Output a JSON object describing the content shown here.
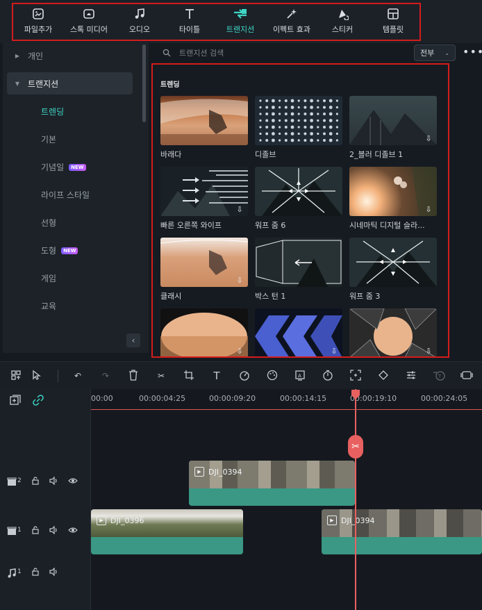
{
  "toolbar": {
    "items": [
      {
        "label": "파일추가",
        "icon": "media-import-icon"
      },
      {
        "label": "스톡 미디어",
        "icon": "stock-media-icon"
      },
      {
        "label": "오디오",
        "icon": "music-note-icon"
      },
      {
        "label": "타이틀",
        "icon": "title-text-icon"
      },
      {
        "label": "트랜지션",
        "icon": "transition-icon"
      },
      {
        "label": "이펙트 효과",
        "icon": "effects-icon"
      },
      {
        "label": "스티커",
        "icon": "sticker-icon"
      },
      {
        "label": "템플릿",
        "icon": "template-icon"
      }
    ],
    "active_index": 4
  },
  "sidebar": {
    "items": [
      {
        "label": "개인",
        "expanded": false
      },
      {
        "label": "트랜지션",
        "expanded": true
      }
    ],
    "sub_items": [
      {
        "label": "트렌딩",
        "active": true,
        "new": false
      },
      {
        "label": "기본",
        "active": false,
        "new": false
      },
      {
        "label": "기념일",
        "active": false,
        "new": true
      },
      {
        "label": "라이프 스타일",
        "active": false,
        "new": false
      },
      {
        "label": "선형",
        "active": false,
        "new": false
      },
      {
        "label": "도형",
        "active": false,
        "new": true
      },
      {
        "label": "게임",
        "active": false,
        "new": false
      },
      {
        "label": "교육",
        "active": false,
        "new": false
      }
    ],
    "new_badge": "NEW"
  },
  "search": {
    "placeholder": "트랜지션 검색"
  },
  "filter": {
    "value": "전부"
  },
  "section": {
    "title": "트렌딩"
  },
  "cards": [
    {
      "name": "바래다",
      "download": false
    },
    {
      "name": "디졸브",
      "download": false
    },
    {
      "name": "2_블러 디졸브 1",
      "download": true
    },
    {
      "name": "빠른 오른쪽 와이프",
      "download": true
    },
    {
      "name": "워프 줌 6",
      "download": false
    },
    {
      "name": "시네마틱 디지털 슬라...",
      "download": true
    },
    {
      "name": "클래시",
      "download": true
    },
    {
      "name": "박스 턴 1",
      "download": false
    },
    {
      "name": "워프 줌 3",
      "download": false
    },
    {
      "name": "",
      "download": true
    },
    {
      "name": "",
      "download": true
    },
    {
      "name": "",
      "download": true
    }
  ],
  "timeline": {
    "ruler": [
      "00:00",
      "00:00:04:25",
      "00:00:09:20",
      "00:00:14:15",
      "00:00:19:10",
      "00:00:24:05"
    ],
    "tracks": [
      {
        "label": "2",
        "kind": "video"
      },
      {
        "label": "1",
        "kind": "video"
      },
      {
        "label": "1",
        "kind": "audio"
      }
    ],
    "clips": [
      {
        "name": "DJI_0394",
        "track": "video-2"
      },
      {
        "name": "DJI_0396",
        "track": "video-1"
      },
      {
        "name": "DJI_0394",
        "track": "video-1"
      }
    ]
  },
  "colors": {
    "accent": "#3ed6c4",
    "highlight": "#d41c1c",
    "playhead": "#e86060",
    "clip": "#3a9884"
  }
}
